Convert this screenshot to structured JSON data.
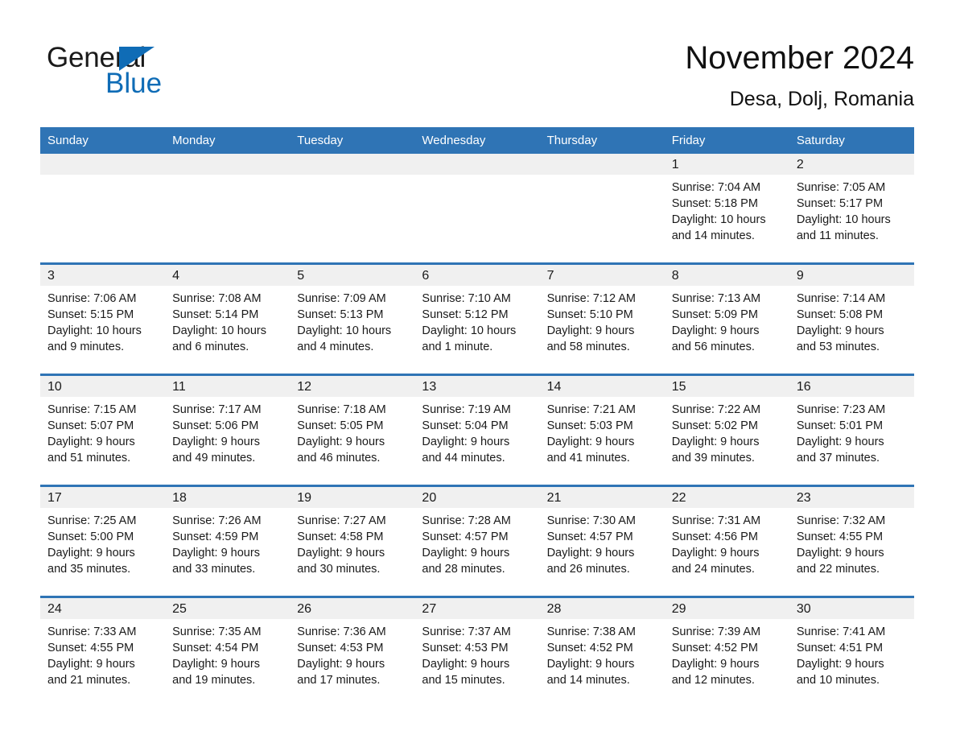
{
  "brand": {
    "name_part1": "General",
    "name_part2": "Blue",
    "accent_color": "#0f6cb6",
    "triangle_icon": "triangle-icon"
  },
  "header": {
    "title": "November 2024",
    "subtitle": "Desa, Dolj, Romania"
  },
  "calendar": {
    "header_bg": "#2f74b5",
    "daynum_bg": "#f0f0f0",
    "weekday_headers": [
      "Sunday",
      "Monday",
      "Tuesday",
      "Wednesday",
      "Thursday",
      "Friday",
      "Saturday"
    ],
    "weeks": [
      [
        {
          "day": ""
        },
        {
          "day": ""
        },
        {
          "day": ""
        },
        {
          "day": ""
        },
        {
          "day": ""
        },
        {
          "day": "1",
          "sunrise": "Sunrise: 7:04 AM",
          "sunset": "Sunset: 5:18 PM",
          "daylight_line1": "Daylight: 10 hours",
          "daylight_line2": "and 14 minutes."
        },
        {
          "day": "2",
          "sunrise": "Sunrise: 7:05 AM",
          "sunset": "Sunset: 5:17 PM",
          "daylight_line1": "Daylight: 10 hours",
          "daylight_line2": "and 11 minutes."
        }
      ],
      [
        {
          "day": "3",
          "sunrise": "Sunrise: 7:06 AM",
          "sunset": "Sunset: 5:15 PM",
          "daylight_line1": "Daylight: 10 hours",
          "daylight_line2": "and 9 minutes."
        },
        {
          "day": "4",
          "sunrise": "Sunrise: 7:08 AM",
          "sunset": "Sunset: 5:14 PM",
          "daylight_line1": "Daylight: 10 hours",
          "daylight_line2": "and 6 minutes."
        },
        {
          "day": "5",
          "sunrise": "Sunrise: 7:09 AM",
          "sunset": "Sunset: 5:13 PM",
          "daylight_line1": "Daylight: 10 hours",
          "daylight_line2": "and 4 minutes."
        },
        {
          "day": "6",
          "sunrise": "Sunrise: 7:10 AM",
          "sunset": "Sunset: 5:12 PM",
          "daylight_line1": "Daylight: 10 hours",
          "daylight_line2": "and 1 minute."
        },
        {
          "day": "7",
          "sunrise": "Sunrise: 7:12 AM",
          "sunset": "Sunset: 5:10 PM",
          "daylight_line1": "Daylight: 9 hours",
          "daylight_line2": "and 58 minutes."
        },
        {
          "day": "8",
          "sunrise": "Sunrise: 7:13 AM",
          "sunset": "Sunset: 5:09 PM",
          "daylight_line1": "Daylight: 9 hours",
          "daylight_line2": "and 56 minutes."
        },
        {
          "day": "9",
          "sunrise": "Sunrise: 7:14 AM",
          "sunset": "Sunset: 5:08 PM",
          "daylight_line1": "Daylight: 9 hours",
          "daylight_line2": "and 53 minutes."
        }
      ],
      [
        {
          "day": "10",
          "sunrise": "Sunrise: 7:15 AM",
          "sunset": "Sunset: 5:07 PM",
          "daylight_line1": "Daylight: 9 hours",
          "daylight_line2": "and 51 minutes."
        },
        {
          "day": "11",
          "sunrise": "Sunrise: 7:17 AM",
          "sunset": "Sunset: 5:06 PM",
          "daylight_line1": "Daylight: 9 hours",
          "daylight_line2": "and 49 minutes."
        },
        {
          "day": "12",
          "sunrise": "Sunrise: 7:18 AM",
          "sunset": "Sunset: 5:05 PM",
          "daylight_line1": "Daylight: 9 hours",
          "daylight_line2": "and 46 minutes."
        },
        {
          "day": "13",
          "sunrise": "Sunrise: 7:19 AM",
          "sunset": "Sunset: 5:04 PM",
          "daylight_line1": "Daylight: 9 hours",
          "daylight_line2": "and 44 minutes."
        },
        {
          "day": "14",
          "sunrise": "Sunrise: 7:21 AM",
          "sunset": "Sunset: 5:03 PM",
          "daylight_line1": "Daylight: 9 hours",
          "daylight_line2": "and 41 minutes."
        },
        {
          "day": "15",
          "sunrise": "Sunrise: 7:22 AM",
          "sunset": "Sunset: 5:02 PM",
          "daylight_line1": "Daylight: 9 hours",
          "daylight_line2": "and 39 minutes."
        },
        {
          "day": "16",
          "sunrise": "Sunrise: 7:23 AM",
          "sunset": "Sunset: 5:01 PM",
          "daylight_line1": "Daylight: 9 hours",
          "daylight_line2": "and 37 minutes."
        }
      ],
      [
        {
          "day": "17",
          "sunrise": "Sunrise: 7:25 AM",
          "sunset": "Sunset: 5:00 PM",
          "daylight_line1": "Daylight: 9 hours",
          "daylight_line2": "and 35 minutes."
        },
        {
          "day": "18",
          "sunrise": "Sunrise: 7:26 AM",
          "sunset": "Sunset: 4:59 PM",
          "daylight_line1": "Daylight: 9 hours",
          "daylight_line2": "and 33 minutes."
        },
        {
          "day": "19",
          "sunrise": "Sunrise: 7:27 AM",
          "sunset": "Sunset: 4:58 PM",
          "daylight_line1": "Daylight: 9 hours",
          "daylight_line2": "and 30 minutes."
        },
        {
          "day": "20",
          "sunrise": "Sunrise: 7:28 AM",
          "sunset": "Sunset: 4:57 PM",
          "daylight_line1": "Daylight: 9 hours",
          "daylight_line2": "and 28 minutes."
        },
        {
          "day": "21",
          "sunrise": "Sunrise: 7:30 AM",
          "sunset": "Sunset: 4:57 PM",
          "daylight_line1": "Daylight: 9 hours",
          "daylight_line2": "and 26 minutes."
        },
        {
          "day": "22",
          "sunrise": "Sunrise: 7:31 AM",
          "sunset": "Sunset: 4:56 PM",
          "daylight_line1": "Daylight: 9 hours",
          "daylight_line2": "and 24 minutes."
        },
        {
          "day": "23",
          "sunrise": "Sunrise: 7:32 AM",
          "sunset": "Sunset: 4:55 PM",
          "daylight_line1": "Daylight: 9 hours",
          "daylight_line2": "and 22 minutes."
        }
      ],
      [
        {
          "day": "24",
          "sunrise": "Sunrise: 7:33 AM",
          "sunset": "Sunset: 4:55 PM",
          "daylight_line1": "Daylight: 9 hours",
          "daylight_line2": "and 21 minutes."
        },
        {
          "day": "25",
          "sunrise": "Sunrise: 7:35 AM",
          "sunset": "Sunset: 4:54 PM",
          "daylight_line1": "Daylight: 9 hours",
          "daylight_line2": "and 19 minutes."
        },
        {
          "day": "26",
          "sunrise": "Sunrise: 7:36 AM",
          "sunset": "Sunset: 4:53 PM",
          "daylight_line1": "Daylight: 9 hours",
          "daylight_line2": "and 17 minutes."
        },
        {
          "day": "27",
          "sunrise": "Sunrise: 7:37 AM",
          "sunset": "Sunset: 4:53 PM",
          "daylight_line1": "Daylight: 9 hours",
          "daylight_line2": "and 15 minutes."
        },
        {
          "day": "28",
          "sunrise": "Sunrise: 7:38 AM",
          "sunset": "Sunset: 4:52 PM",
          "daylight_line1": "Daylight: 9 hours",
          "daylight_line2": "and 14 minutes."
        },
        {
          "day": "29",
          "sunrise": "Sunrise: 7:39 AM",
          "sunset": "Sunset: 4:52 PM",
          "daylight_line1": "Daylight: 9 hours",
          "daylight_line2": "and 12 minutes."
        },
        {
          "day": "30",
          "sunrise": "Sunrise: 7:41 AM",
          "sunset": "Sunset: 4:51 PM",
          "daylight_line1": "Daylight: 9 hours",
          "daylight_line2": "and 10 minutes."
        }
      ]
    ]
  }
}
